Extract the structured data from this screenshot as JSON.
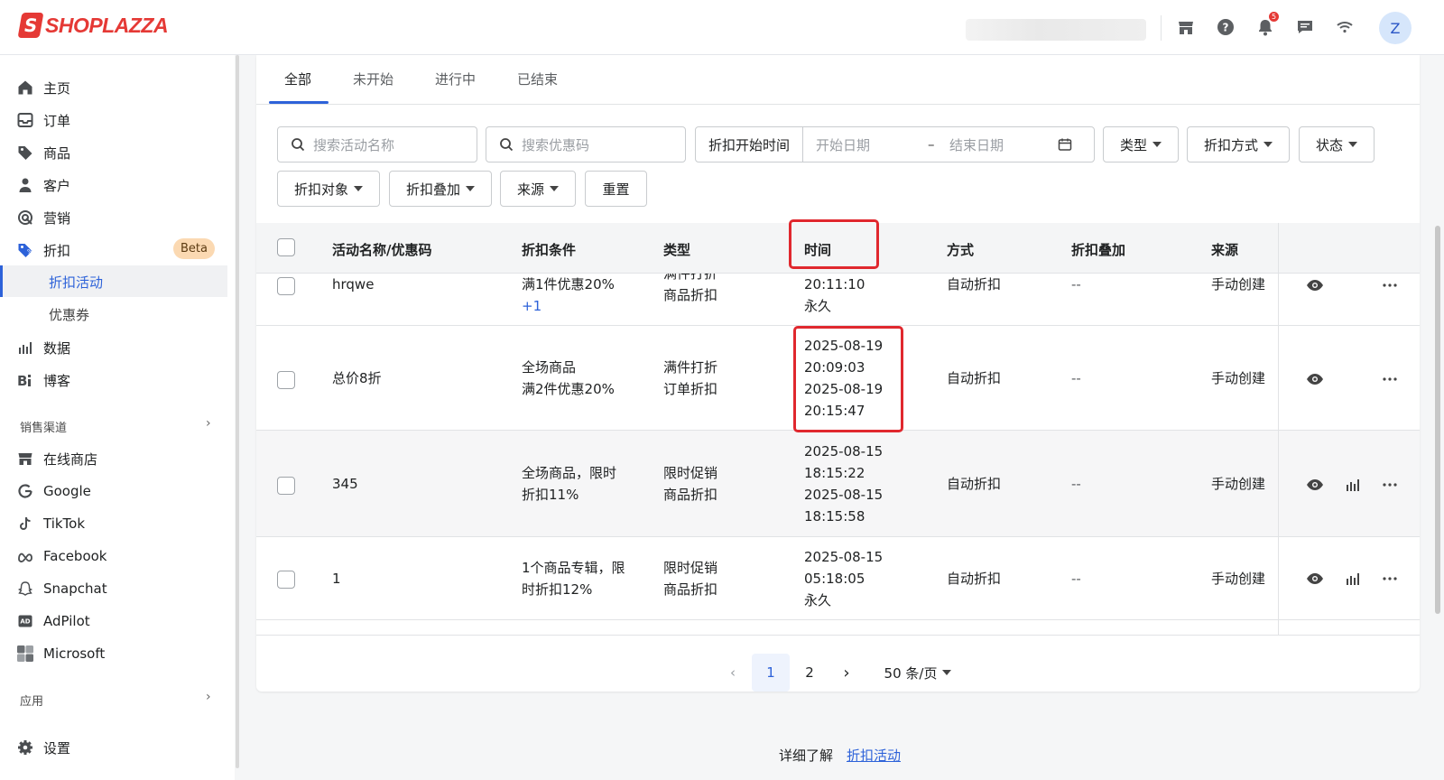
{
  "brand": {
    "logo_text": "SHOPLAZZA",
    "accent": "#2d62d9",
    "danger": "#e53935"
  },
  "topbar": {
    "icons": [
      "store-icon",
      "help-icon",
      "bell-icon",
      "chat-icon",
      "wifi-icon"
    ],
    "notification_count": "5",
    "avatar_initial": "Z"
  },
  "sidebar": {
    "items": [
      {
        "label": "主页",
        "icon": "home-icon"
      },
      {
        "label": "订单",
        "icon": "inbox-icon"
      },
      {
        "label": "商品",
        "icon": "tag-icon"
      },
      {
        "label": "客户",
        "icon": "person-icon"
      },
      {
        "label": "营销",
        "icon": "target-icon"
      },
      {
        "label": "折扣",
        "icon": "discount-icon"
      }
    ],
    "beta_badge": "Beta",
    "sub_items": [
      {
        "label": "折扣活动",
        "active": true
      },
      {
        "label": "优惠券",
        "active": false
      }
    ],
    "items2": [
      {
        "label": "数据",
        "icon": "chart-icon"
      },
      {
        "label": "博客",
        "icon": "blog-icon"
      }
    ],
    "channels_heading": "销售渠道",
    "channels": [
      {
        "label": "在线商店",
        "icon": "store-icon"
      },
      {
        "label": "Google",
        "icon": "google-icon"
      },
      {
        "label": "TikTok",
        "icon": "tiktok-icon"
      },
      {
        "label": "Facebook",
        "icon": "meta-icon"
      },
      {
        "label": "Snapchat",
        "icon": "snapchat-icon"
      },
      {
        "label": "AdPilot",
        "icon": "adpilot-icon"
      },
      {
        "label": "Microsoft",
        "icon": "microsoft-icon"
      }
    ],
    "apps_heading": "应用",
    "settings_label": "设置"
  },
  "tabs": [
    "全部",
    "未开始",
    "进行中",
    "已结束"
  ],
  "filters": {
    "search_activity_placeholder": "搜索活动名称",
    "search_coupon_placeholder": "搜索优惠码",
    "date_label": "折扣开始时间",
    "start_placeholder": "开始日期",
    "date_dash": "–",
    "end_placeholder": "结束日期",
    "type": "类型",
    "method": "折扣方式",
    "status": "状态",
    "target": "折扣对象",
    "stacking": "折扣叠加",
    "source": "来源",
    "reset": "重置"
  },
  "table": {
    "columns": [
      "活动名称/优惠码",
      "折扣条件",
      "类型",
      "时间",
      "方式",
      "折扣叠加",
      "来源"
    ],
    "rows": [
      {
        "name": "hrqwe",
        "condition": [
          "满1件优惠20%"
        ],
        "condition_extra": "+1",
        "type": [
          "满件打折",
          "商品折扣"
        ],
        "time": [
          "20:11:10",
          "永久"
        ],
        "method": "自动折扣",
        "stacking": "--",
        "source": "手动创建"
      },
      {
        "name": "总价8折",
        "condition": [
          "全场商品",
          "满2件优惠20%"
        ],
        "type": [
          "满件打折",
          "订单折扣"
        ],
        "time": [
          "2025-08-19",
          "20:09:03",
          "2025-08-19",
          "20:15:47"
        ],
        "method": "自动折扣",
        "stacking": "--",
        "source": "手动创建"
      },
      {
        "name": "345",
        "condition": [
          "全场商品，限时",
          "折扣11%"
        ],
        "type": [
          "限时促销",
          "商品折扣"
        ],
        "time": [
          "2025-08-15",
          "18:15:22",
          "2025-08-15",
          "18:15:58"
        ],
        "method": "自动折扣",
        "stacking": "--",
        "source": "手动创建"
      },
      {
        "name": "1",
        "condition": [
          "1个商品专辑，限",
          "时折扣12%"
        ],
        "type": [
          "限时促销",
          "商品折扣"
        ],
        "time": [
          "2025-08-15",
          "05:18:05",
          "永久"
        ],
        "method": "自动折扣",
        "stacking": "--",
        "source": "手动创建"
      }
    ]
  },
  "pagination": {
    "current": "1",
    "next_page": "2",
    "page_size": "50 条/页"
  },
  "footer": {
    "text": "详细了解",
    "link": "折扣活动"
  }
}
